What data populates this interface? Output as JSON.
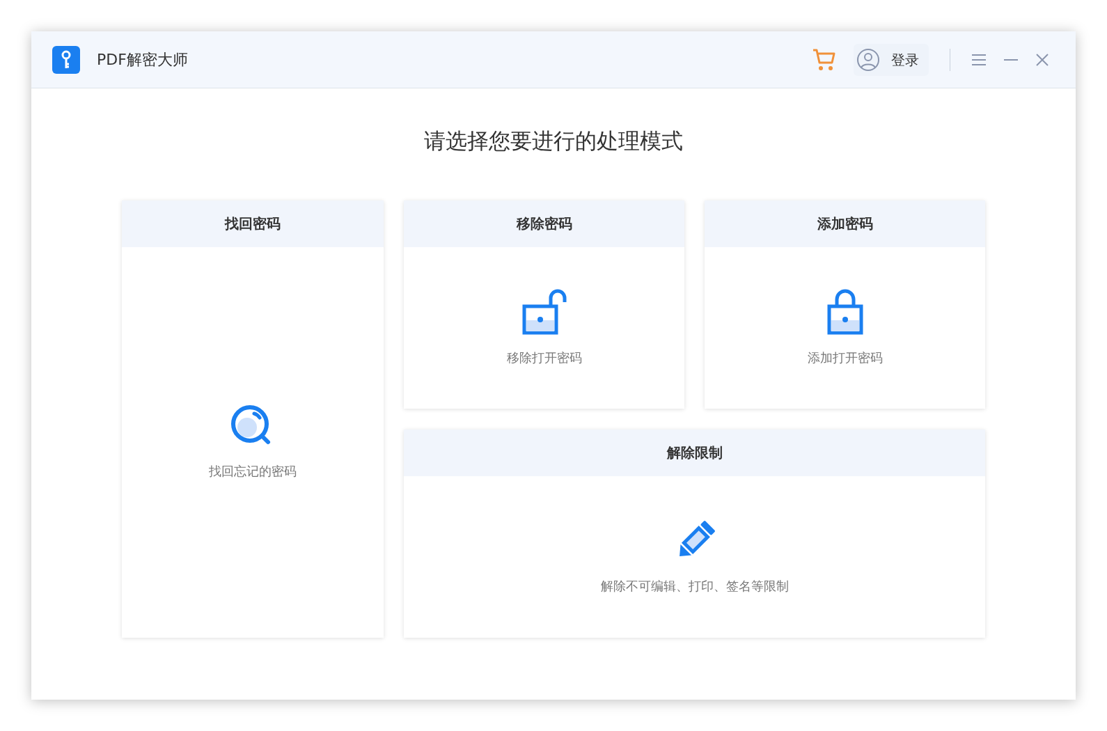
{
  "window": {
    "title": "PDF解密大师",
    "login": "登录"
  },
  "heading": "请选择您要进行的处理模式",
  "cards": [
    {
      "kind": "search",
      "title": "找回密码",
      "description": "找回忘记的密码"
    },
    {
      "kind": "unlock",
      "title": "移除密码",
      "description": "移除打开密码"
    },
    {
      "kind": "lock",
      "title": "添加密码",
      "description": "添加打开密码"
    },
    {
      "kind": "edit",
      "title": "解除限制",
      "description": "解除不可编辑、打印、签名等限制"
    }
  ]
}
